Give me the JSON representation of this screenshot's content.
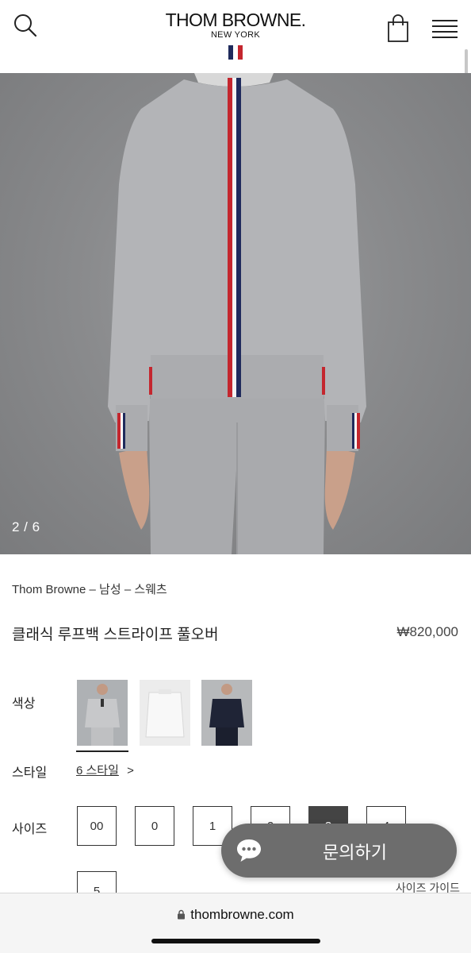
{
  "header": {
    "brand": "THOM BROWNE.",
    "brand_sub": "NEW YORK",
    "flag_colors": [
      "#1f2a5c",
      "#ffffff",
      "#c4262e"
    ]
  },
  "gallery": {
    "counter": "2 / 6"
  },
  "product": {
    "breadcrumb": "Thom Browne – 남성 – 스웨츠",
    "title": "클래식 루프백 스트라이프 풀오버",
    "price": "₩820,000"
  },
  "options": {
    "color_label": "색상",
    "style_label": "스타일",
    "style_link": "6 스타일",
    "style_chevron": ">",
    "size_label": "사이즈",
    "sizes": [
      "00",
      "0",
      "1",
      "2",
      "3",
      "4",
      "5"
    ],
    "selected_size": "3",
    "size_guide": "사이즈 가이드"
  },
  "chat": {
    "label": "문의하기"
  },
  "browser": {
    "url": "thombrowne.com"
  },
  "colors": {
    "accent_dark": "#444444",
    "chat_bg": "#6d6d6d",
    "tricolor_red": "#c4262e",
    "tricolor_navy": "#1f2a5c"
  }
}
